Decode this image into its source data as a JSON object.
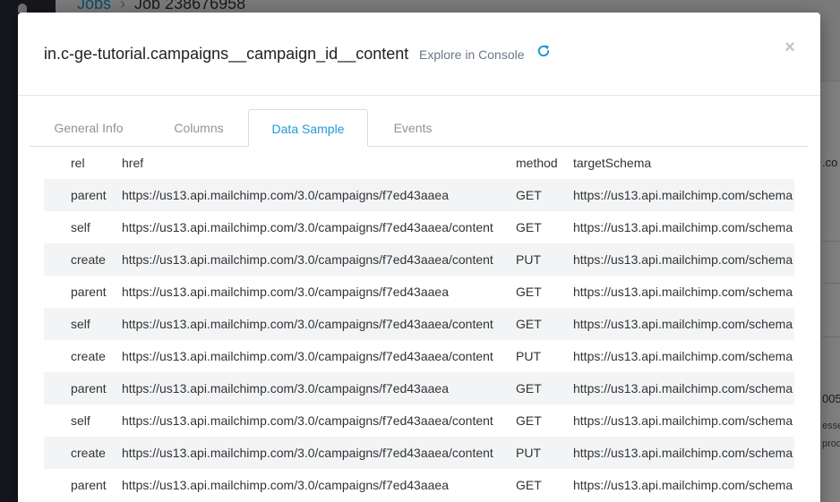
{
  "background": {
    "breadcrumb": {
      "parent": "Jobs",
      "current": "Job 238676958"
    },
    "snippets": {
      "s1": ".co",
      "s2": "005",
      "s3": "esse",
      "s4": "proc"
    }
  },
  "modal": {
    "title": "in.c-ge-tutorial.campaigns__campaign_id__content",
    "explore_label": "Explore in Console",
    "close_label": "×",
    "accent_color": "#1f9ad6"
  },
  "tabs": [
    {
      "label": "General Info"
    },
    {
      "label": "Columns"
    },
    {
      "label": "Data Sample",
      "active": true
    },
    {
      "label": "Events"
    }
  ],
  "table": {
    "columns": [
      "rel",
      "href",
      "method",
      "targetSchema"
    ],
    "rows": [
      [
        "parent",
        "https://us13.api.mailchimp.com/3.0/campaigns/f7ed43aaea",
        "GET",
        "https://us13.api.mailchimp.com/schema"
      ],
      [
        "self",
        "https://us13.api.mailchimp.com/3.0/campaigns/f7ed43aaea/content",
        "GET",
        "https://us13.api.mailchimp.com/schema"
      ],
      [
        "create",
        "https://us13.api.mailchimp.com/3.0/campaigns/f7ed43aaea/content",
        "PUT",
        "https://us13.api.mailchimp.com/schema"
      ],
      [
        "parent",
        "https://us13.api.mailchimp.com/3.0/campaigns/f7ed43aaea",
        "GET",
        "https://us13.api.mailchimp.com/schema"
      ],
      [
        "self",
        "https://us13.api.mailchimp.com/3.0/campaigns/f7ed43aaea/content",
        "GET",
        "https://us13.api.mailchimp.com/schema"
      ],
      [
        "create",
        "https://us13.api.mailchimp.com/3.0/campaigns/f7ed43aaea/content",
        "PUT",
        "https://us13.api.mailchimp.com/schema"
      ],
      [
        "parent",
        "https://us13.api.mailchimp.com/3.0/campaigns/f7ed43aaea",
        "GET",
        "https://us13.api.mailchimp.com/schema"
      ],
      [
        "self",
        "https://us13.api.mailchimp.com/3.0/campaigns/f7ed43aaea/content",
        "GET",
        "https://us13.api.mailchimp.com/schema"
      ],
      [
        "create",
        "https://us13.api.mailchimp.com/3.0/campaigns/f7ed43aaea/content",
        "PUT",
        "https://us13.api.mailchimp.com/schema"
      ],
      [
        "parent",
        "https://us13.api.mailchimp.com/3.0/campaigns/f7ed43aaea",
        "GET",
        "https://us13.api.mailchimp.com/schema"
      ]
    ]
  }
}
